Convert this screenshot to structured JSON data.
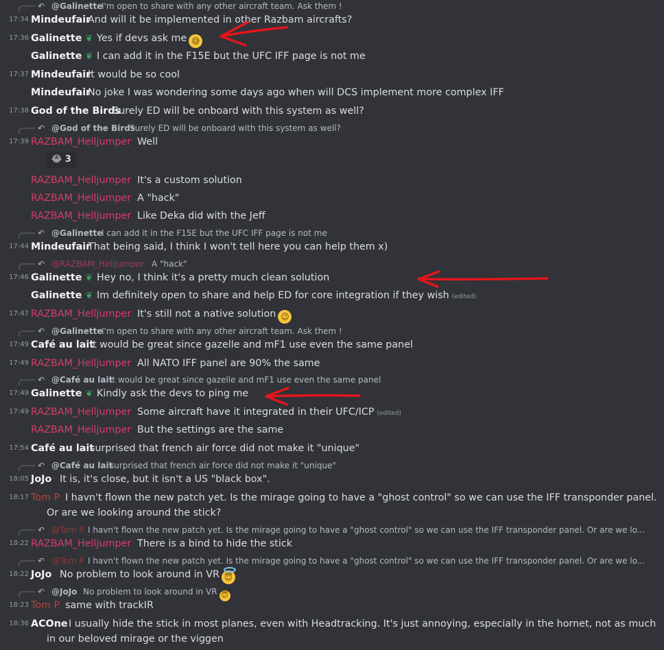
{
  "messages": {
    "r0": {
      "name": "@Galinette",
      "text": "I'm open to share with any other aircraft team. Ask them !"
    },
    "m1": {
      "time": "17:34",
      "author": "Mindeufair",
      "text": "And will it be implemented in other Razbam aircrafts?"
    },
    "m2": {
      "time": "17:36",
      "author": "Galinette",
      "leaf": "❦",
      "text": "Yes if devs ask me",
      "emoji": "😅"
    },
    "m3": {
      "author": "Galinette",
      "leaf": "❦",
      "text": "I can add it in the F15E but the UFC IFF page is not me"
    },
    "m4": {
      "time": "17:37",
      "author": "Mindeufair",
      "text": "It would be so cool"
    },
    "m5": {
      "author": "Mindeufair",
      "text": "No joke I was wondering some days ago when will DCS implement more complex IFF"
    },
    "m6": {
      "time": "17:38",
      "author": "God of the Birds",
      "text": "Surely ED will be onboard with this system as well?"
    },
    "r7": {
      "name": "@God of the Birds",
      "text": "Surely ED will be onboard with this system as well?"
    },
    "m7": {
      "time": "17:39",
      "author": "RAZBAM_Helljumper",
      "text": "Well"
    },
    "reaction": {
      "emoji": "😂",
      "count": "3"
    },
    "m8": {
      "author": "RAZBAM_Helljumper",
      "text": "It's a custom solution"
    },
    "m9": {
      "author": "RAZBAM_Helljumper",
      "text": "A \"hack\""
    },
    "m10": {
      "author": "RAZBAM_Helljumper",
      "text": "Like Deka did with the Jeff"
    },
    "r11": {
      "name": "@Galinette",
      "text": "I can add it in the F15E but the UFC IFF page is not me"
    },
    "m11": {
      "time": "17:44",
      "author": "Mindeufair",
      "text": "That being said, I think I won't tell here you can help them x)"
    },
    "r12": {
      "name": "@RAZBAM_Helljumper",
      "text": "A \"hack\""
    },
    "m12": {
      "time": "17:46",
      "author": "Galinette",
      "leaf": "❦",
      "text": "Hey no, I think it's a pretty much clean solution"
    },
    "m13": {
      "author": "Galinette",
      "leaf": "❦",
      "text": "Im definitely open to share and help ED for core integration if they wish",
      "edited": "(edited)"
    },
    "m14": {
      "time": "17:47",
      "author": "RAZBAM_Helljumper",
      "text": "It's still not a native solution",
      "emoji": "😉"
    },
    "r15": {
      "name": "@Galinette",
      "text": "I'm open to share with any other aircraft team. Ask them !"
    },
    "m15": {
      "time": "17:49",
      "author": "Café au lait",
      "text": "it would be great since gazelle and mF1 use even the same panel"
    },
    "m16": {
      "time": "17:49",
      "author": "RAZBAM_Helljumper",
      "text": "All NATO IFF panel are 90% the same"
    },
    "r17": {
      "name": "@Café au lait",
      "text": "it would be great since gazelle and mF1 use even the same panel"
    },
    "m17": {
      "time": "17:49",
      "author": "Galinette",
      "leaf": "❦",
      "text": "Kindly ask the devs to ping me"
    },
    "m18": {
      "time": "17:49",
      "author": "RAZBAM_Helljumper",
      "text": "Some aircraft have it integrated in their UFC/ICP",
      "edited": "(edited)"
    },
    "m19": {
      "author": "RAZBAM_Helljumper",
      "text": "But the settings are the same"
    },
    "m20": {
      "time": "17:54",
      "author": "Café au lait",
      "text": "surprised that french air force did not make it \"unique\""
    },
    "r21": {
      "name": "@Café au lait",
      "text": "surprised that french air force did not make it \"unique\""
    },
    "m21": {
      "time": "18:05",
      "author": "JoJo",
      "text": "It is, it's close, but it isn't a US \"black box\"."
    },
    "m22": {
      "time": "18:17",
      "author": "Tom P",
      "text": "I havn't flown the new patch yet. Is the mirage going to have a \"ghost control\" so we can use the IFF transponder panel.",
      "text2": "Or are we looking around the stick?"
    },
    "r23": {
      "name": "@Tom P",
      "text": "I havn't flown the new patch yet. Is the mirage going to have a \"ghost control\" so we can use the IFF transponder panel. Or are we lo..."
    },
    "m23": {
      "time": "18:22",
      "author": "RAZBAM_Helljumper",
      "text": "There is a bind to hide the stick"
    },
    "r24": {
      "name": "@Tom P",
      "text": "I havn't flown the new patch yet. Is the mirage going to have a \"ghost control\" so we can use the IFF transponder panel. Or are we lo..."
    },
    "m24": {
      "time": "18:22",
      "author": "JoJo",
      "text": "No problem to look around in VR",
      "emoji": "😇"
    },
    "r25": {
      "name": "@JoJo",
      "text": "No problem to look around in VR",
      "emoji": "😇"
    },
    "m25": {
      "time": "18:23",
      "author": "Tom P",
      "text": "same with trackIR"
    },
    "m26": {
      "time": "18:36",
      "author": "ACOne",
      "text": "I usually hide the stick in most planes, even with Headtracking. It's just annoying, especially in the hornet, not as much",
      "text2": "in our beloved mirage or the viggen"
    }
  },
  "colors": {
    "background": "#313338",
    "role_red": "#d83c6a",
    "annotation_arrow": "#e3161c"
  },
  "icons": {
    "reply": "reply-arrow-icon",
    "leaf": "sprout-icon"
  }
}
